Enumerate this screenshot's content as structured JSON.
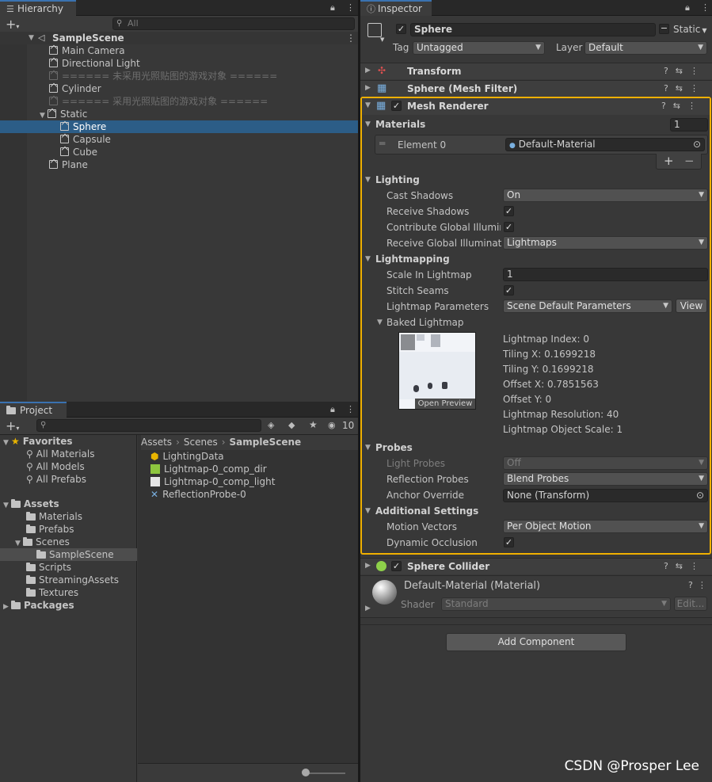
{
  "hierarchy": {
    "tab": "Hierarchy",
    "search_placeholder": "All",
    "scene": "SampleScene",
    "items": [
      "Main Camera",
      "Directional Light",
      "====== 未采用光照贴图的游戏对象 ======",
      "Cylinder",
      "====== 采用光照贴图的游戏对象 ======",
      "Static",
      "Sphere",
      "Capsule",
      "Cube",
      "Plane"
    ]
  },
  "project": {
    "tab": "Project",
    "hidden_count": "10",
    "favorites": {
      "label": "Favorites",
      "items": [
        "All Materials",
        "All Models",
        "All Prefabs"
      ]
    },
    "assets": {
      "label": "Assets",
      "items": [
        "Materials",
        "Prefabs",
        "Scenes",
        "SampleScene",
        "Scripts",
        "StreamingAssets",
        "Textures"
      ]
    },
    "packages": "Packages",
    "breadcrumb": [
      "Assets",
      "Scenes",
      "SampleScene"
    ],
    "files": [
      "LightingData",
      "Lightmap-0_comp_dir",
      "Lightmap-0_comp_light",
      "ReflectionProbe-0"
    ]
  },
  "inspector": {
    "tab": "Inspector",
    "object_name": "Sphere",
    "static_label": "Static",
    "tag_label": "Tag",
    "tag_value": "Untagged",
    "layer_label": "Layer",
    "layer_value": "Default",
    "components": {
      "transform": "Transform",
      "mesh_filter": "Sphere (Mesh Filter)",
      "mesh_renderer": "Mesh Renderer",
      "sphere_collider": "Sphere Collider"
    },
    "materials": {
      "label": "Materials",
      "count": "1",
      "element_label": "Element 0",
      "element_value": "Default-Material"
    },
    "lighting": {
      "label": "Lighting",
      "cast_shadows_label": "Cast Shadows",
      "cast_shadows_value": "On",
      "receive_shadows_label": "Receive Shadows",
      "contribute_gi_label": "Contribute Global Illumina",
      "receive_gi_label": "Receive Global Illuminatio",
      "receive_gi_value": "Lightmaps"
    },
    "lightmapping": {
      "label": "Lightmapping",
      "scale_label": "Scale In Lightmap",
      "scale_value": "1",
      "stitch_label": "Stitch Seams",
      "params_label": "Lightmap Parameters",
      "params_value": "Scene Default Parameters",
      "view_button": "View",
      "baked_label": "Baked Lightmap",
      "open_preview": "Open Preview",
      "info": [
        "Lightmap Index: 0",
        "Tiling X: 0.1699218",
        "Tiling Y: 0.1699218",
        "Offset X: 0.7851563",
        "Offset Y: 0",
        "Lightmap Resolution: 40",
        "Lightmap Object Scale: 1"
      ]
    },
    "probes": {
      "label": "Probes",
      "light_probes_label": "Light Probes",
      "light_probes_value": "Off",
      "reflection_label": "Reflection Probes",
      "reflection_value": "Blend Probes",
      "anchor_label": "Anchor Override",
      "anchor_value": "None (Transform)"
    },
    "additional": {
      "label": "Additional Settings",
      "motion_label": "Motion Vectors",
      "motion_value": "Per Object Motion",
      "occlusion_label": "Dynamic Occlusion"
    },
    "material_preview": {
      "name": "Default-Material (Material)",
      "shader_label": "Shader",
      "shader_value": "Standard",
      "edit_button": "Edit..."
    },
    "add_component": "Add Component"
  },
  "watermark": "CSDN @Prosper Lee",
  "colors": {
    "highlight": "#f0b000",
    "selection": "#2c5d87",
    "tab_accent": "#3a72b0"
  }
}
